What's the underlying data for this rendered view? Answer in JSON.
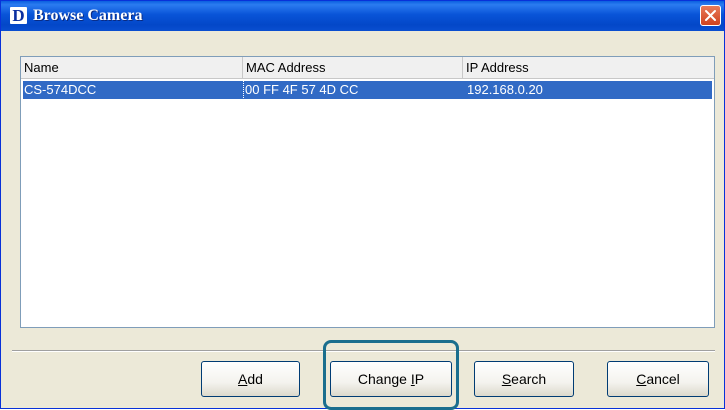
{
  "window": {
    "title": "Browse Camera",
    "logo_letter": "D"
  },
  "list": {
    "columns": [
      "Name",
      "MAC Address",
      "IP Address"
    ],
    "rows": [
      {
        "name": "CS-574DCC",
        "mac": "00 FF 4F 57 4D CC",
        "ip": "192.168.0.20",
        "selected": true
      }
    ]
  },
  "buttons": {
    "add": {
      "pre": "",
      "accel": "A",
      "post": "dd"
    },
    "change_ip": {
      "pre": "Change ",
      "accel": "I",
      "post": "P"
    },
    "search": {
      "pre": "",
      "accel": "S",
      "post": "earch"
    },
    "cancel": {
      "pre": "",
      "accel": "C",
      "post": "ancel"
    }
  },
  "colors": {
    "selection": "#316ac5",
    "highlight_frame": "#1a6e8e"
  }
}
